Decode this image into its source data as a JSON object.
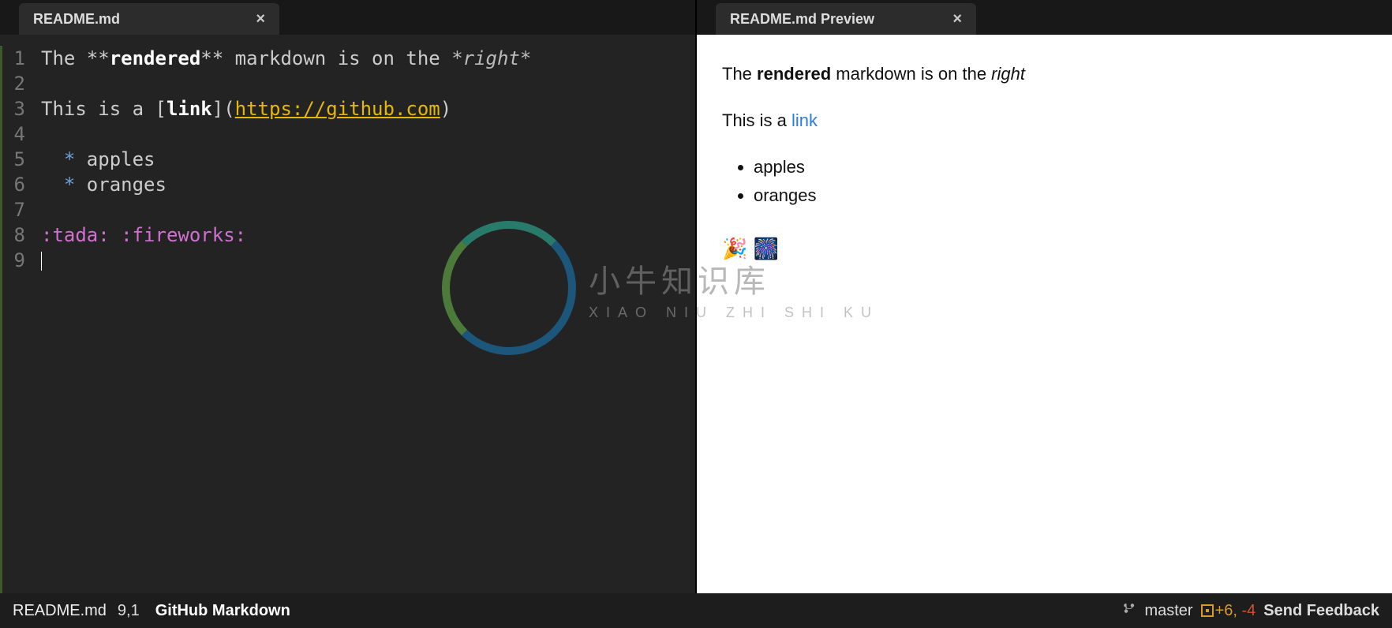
{
  "tabs": {
    "editor": {
      "title": "README.md"
    },
    "preview": {
      "title": "README.md Preview"
    }
  },
  "editor": {
    "lines": [
      "1",
      "2",
      "3",
      "4",
      "5",
      "6",
      "7",
      "8",
      "9"
    ],
    "line1_a": "The ",
    "line1_b": "**",
    "line1_c": "rendered",
    "line1_d": "**",
    "line1_e": " markdown is on the ",
    "line1_f": "*right*",
    "line3_a": "This is a [",
    "line3_b": "link",
    "line3_c": "](",
    "line3_url": "https://github.com",
    "line3_d": ")",
    "line5_bullet": "  * ",
    "line5_item": "apples",
    "line6_bullet": "  * ",
    "line6_item": "oranges",
    "line8_a": ":tada:",
    "line8_sp": " ",
    "line8_b": ":fireworks:"
  },
  "preview": {
    "p1_a": "The ",
    "p1_b": "rendered",
    "p1_c": " markdown is on the ",
    "p1_d": "right",
    "p2_a": "This is a ",
    "p2_link": "link",
    "li1": "apples",
    "li2": "oranges",
    "emoji1": "🎉",
    "emoji2": "🎆"
  },
  "status": {
    "filename": "README.md",
    "position": "9,1",
    "grammar": "GitHub Markdown",
    "branch": "master",
    "diff_add": "+6, ",
    "diff_del": "-4",
    "feedback": "Send Feedback"
  },
  "watermark": {
    "title": "小牛知识库",
    "sub": "XIAO NIU ZHI SHI KU"
  }
}
